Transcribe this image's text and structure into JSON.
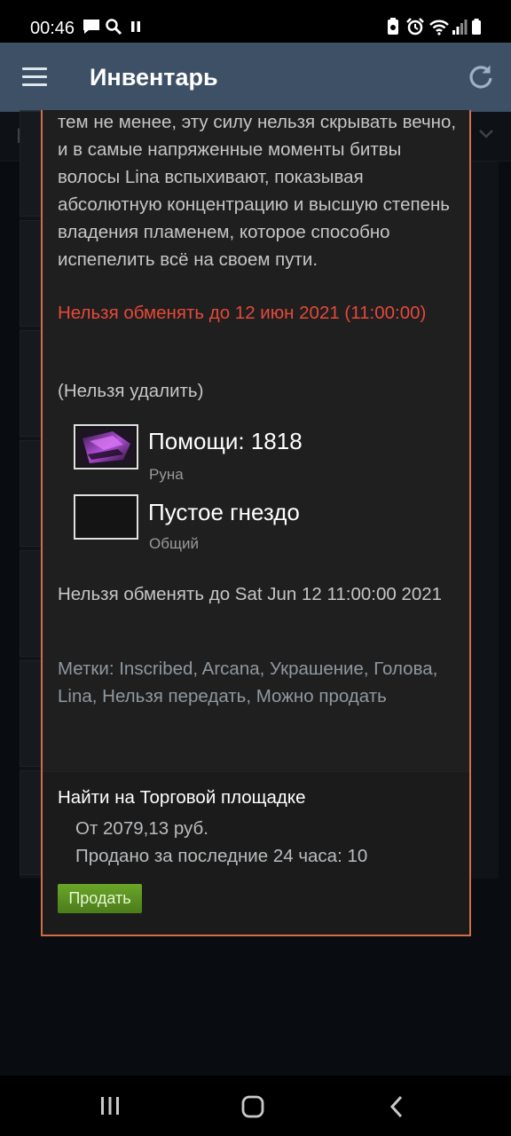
{
  "status_bar": {
    "time": "00:46"
  },
  "app_bar": {
    "title": "Инвентарь"
  },
  "background": {
    "filter_value": "Do"
  },
  "item": {
    "description": "тем не менее, эту силу нельзя скрывать вечно, и в самые напряженные моменты битвы волосы Lina вспыхивают, показывая абсолютную концентрацию и высшую степень владения пламенем, которое способно испепелить всё на своем пути.",
    "trade_restriction_warning": "Нельзя обменять до 12 июн 2021 (11:00:00)",
    "no_delete": "(Нельзя удалить)",
    "gems": [
      {
        "name": "Помощи: 1818",
        "type": "Руна",
        "icon": "rune-gem"
      },
      {
        "name": "Пустое гнездо",
        "type": "Общий",
        "icon": "empty-socket"
      }
    ],
    "cannot_trade_until": "Нельзя обменять до Sat Jun 12 11:00:00 2021",
    "tags": "Метки: Inscribed, Arcana, Украшение, Голова, Lina, Нельзя передать, Можно продать"
  },
  "market": {
    "title": "Найти на Торговой площадке",
    "price": "От 2079,13 руб.",
    "sold": "Продано за последние 24 часа: 10",
    "sell_label": "Продать"
  },
  "colors": {
    "app_bar": "#3d5066",
    "modal_border": "#d06f46",
    "warning": "#e5493a",
    "sell_button": "#5a9421"
  }
}
